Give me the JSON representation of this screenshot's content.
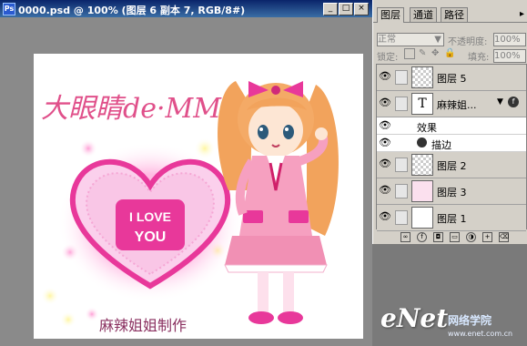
{
  "window": {
    "title": "0000.psd @ 100% (图层 6 副本 7, RGB/8#)",
    "icon_text": "Ps",
    "minimize": "_",
    "maximize": "□",
    "close": "×"
  },
  "canvas": {
    "headline": "大眼睛de·MM",
    "heart_text_1": "I LOVE",
    "heart_text_2": "YOU",
    "caption": "麻辣姐姐制作"
  },
  "layers_panel": {
    "tabs": [
      "图层",
      "通道",
      "路径"
    ],
    "blend_mode": "正常",
    "opacity_label": "不透明度:",
    "opacity_value": "100%",
    "lock_label": "锁定:",
    "fill_label": "填充:",
    "fill_value": "100%",
    "layers": [
      {
        "name": "图层 5",
        "type": "raster"
      },
      {
        "name": "麻辣姐...",
        "type": "text",
        "thumb_text": "T"
      },
      {
        "name": "效果",
        "type": "effects"
      },
      {
        "name": "描边",
        "type": "effect"
      },
      {
        "name": "图层 2",
        "type": "raster"
      },
      {
        "name": "图层 3",
        "type": "raster"
      },
      {
        "name": "图层 1",
        "type": "raster"
      }
    ],
    "footer_icons": [
      "link-icon",
      "fx-icon",
      "mask-icon",
      "folder-icon",
      "adjust-icon",
      "new-layer-icon",
      "trash-icon"
    ]
  },
  "watermark": {
    "brand": "eNet",
    "chinese": "网络学院",
    "url": "www.enet.com.cn"
  },
  "colors": {
    "title_bar": "#0a246a",
    "panel_bg": "#d4d0c8",
    "heart_pink": "#e8389a",
    "headline_pink": "#e0508a"
  }
}
